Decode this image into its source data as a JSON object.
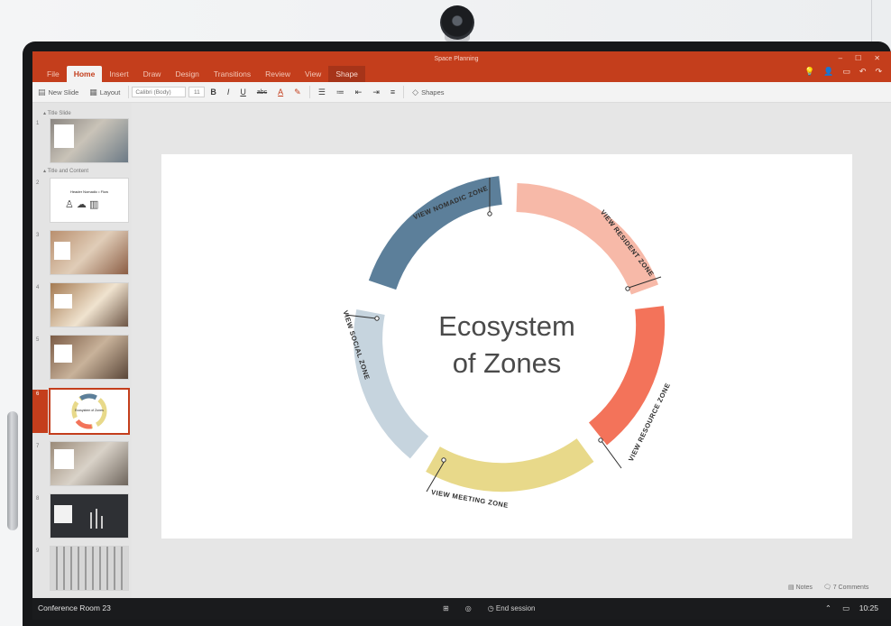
{
  "app": {
    "doc_title": "Space Planning",
    "window_controls": [
      "–",
      "☐",
      "✕"
    ],
    "quick_icons": [
      "lightbulb-icon",
      "share-icon",
      "present-icon",
      "undo-icon",
      "redo-icon"
    ]
  },
  "tabs": [
    {
      "label": "File"
    },
    {
      "label": "Home"
    },
    {
      "label": "Insert"
    },
    {
      "label": "Draw"
    },
    {
      "label": "Design"
    },
    {
      "label": "Transitions"
    },
    {
      "label": "Review"
    },
    {
      "label": "View"
    },
    {
      "label": "Shape"
    }
  ],
  "ribbon": {
    "new_slide": "New Slide",
    "layout": "Layout",
    "font": "Calibri (Body)",
    "size": "11",
    "bold": "B",
    "italic": "I",
    "underline": "U",
    "strike": "abc",
    "font_color": "A",
    "shapes": "Shapes"
  },
  "pane": {
    "section1": "Title Slide",
    "section2": "Title and Content",
    "slides": [
      "1",
      "2",
      "3",
      "4",
      "5",
      "6",
      "7",
      "8",
      "9"
    ],
    "thumb2_text": "Header Nomadic • Flow",
    "thumb6_text": "Ecosystem of Zones",
    "selected": "6"
  },
  "slide": {
    "title_line1": "Ecosystem",
    "title_line2": "of Zones",
    "zones": {
      "nomadic": "VIEW NOMADIC ZONE",
      "resident": "VIEW RESIDENT ZONE",
      "resource": "VIEW RESOURCE ZONE",
      "meeting": "VIEW MEETING ZONE",
      "social": "VIEW SOCIAL ZONE"
    },
    "colors": {
      "nomadic": "#5c7f9a",
      "resident": "#f7b9a8",
      "resource": "#f3735a",
      "meeting": "#e8d98a",
      "social": "#c6d4de"
    }
  },
  "footer": {
    "notes": "Notes",
    "comments": "7 Comments"
  },
  "status": {
    "room": "Conference Room 23",
    "end_session": "End session",
    "time": "10:25"
  }
}
